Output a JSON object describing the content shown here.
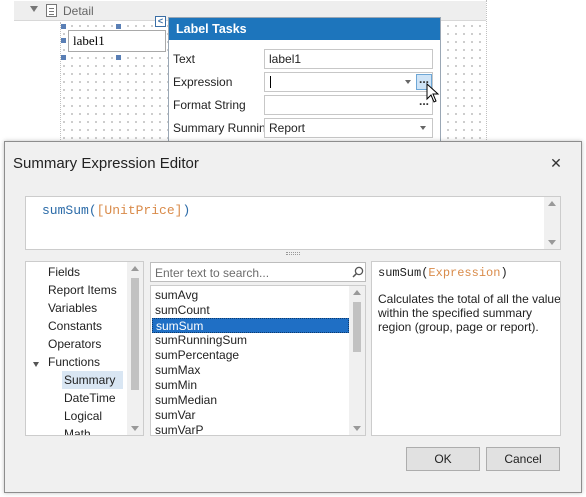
{
  "designer": {
    "band_title": "Detail",
    "label_text": "label1"
  },
  "tasks": {
    "title": "Label Tasks",
    "rows": {
      "text_label": "Text",
      "text_value": "label1",
      "expression_label": "Expression",
      "expression_value": "",
      "format_label": "Format String",
      "format_value": "",
      "summary_label": "Summary Running",
      "summary_value": "Report"
    }
  },
  "dialog": {
    "title": "Summary Expression Editor",
    "expression": {
      "function": "sumSum",
      "open": "(",
      "argument": "[UnitPrice]",
      "close": ")"
    },
    "tree": {
      "items": [
        "Fields",
        "Report Items",
        "Variables",
        "Constants",
        "Operators",
        "Functions"
      ],
      "children": [
        "Summary",
        "DateTime",
        "Logical",
        "Math"
      ],
      "selected_child": "Summary"
    },
    "search": {
      "placeholder": "Enter text to search..."
    },
    "functions": [
      "sumAvg",
      "sumCount",
      "sumSum",
      "sumRunningSum",
      "sumPercentage",
      "sumMax",
      "sumMin",
      "sumMedian",
      "sumVar",
      "sumVarP"
    ],
    "selected_function": "sumSum",
    "description": {
      "signature_fn": "sumSum",
      "signature_open": "(",
      "signature_param": "Expression",
      "signature_close": ")",
      "text": "Calculates the total of all the values within the specified summary region (group, page or report)."
    },
    "buttons": {
      "ok": "OK",
      "cancel": "Cancel"
    }
  },
  "colors": {
    "accent": "#1d75bc",
    "selection": "#1f6fc5",
    "function_text": "#2b6ba8",
    "parameter_text": "#d98b4a"
  }
}
